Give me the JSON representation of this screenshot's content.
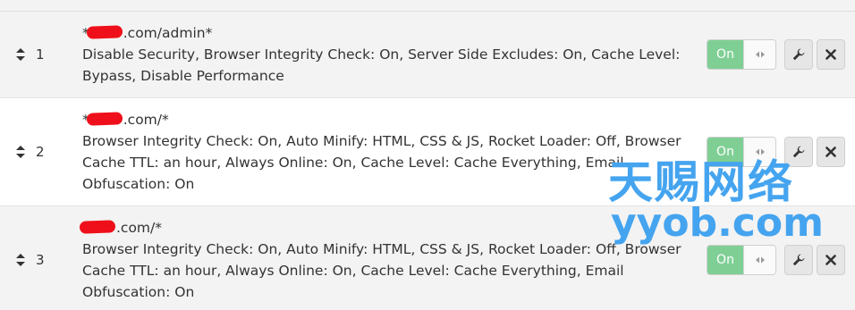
{
  "rules": [
    {
      "number": "1",
      "url_prefix": "*",
      "url_suffix": ".com/admin*",
      "settings": "Disable Security, Browser Integrity Check: On, Server Side Excludes: On, Cache Level: Bypass, Disable Performance",
      "toggle_label": "On"
    },
    {
      "number": "2",
      "url_prefix": "*",
      "url_suffix": ".com/*",
      "settings": "Browser Integrity Check: On, Auto Minify: HTML, CSS & JS, Rocket Loader: Off, Browser Cache TTL: an hour, Always Online: On, Cache Level: Cache Everything, Email Obfuscation: On",
      "toggle_label": "On"
    },
    {
      "number": "3",
      "url_prefix": "",
      "url_suffix": ".com/*",
      "settings": "Browser Integrity Check: On, Auto Minify: HTML, CSS & JS, Rocket Loader: Off, Browser Cache TTL: an hour, Always Online: On, Cache Level: Cache Everything, Email Obfuscation: On",
      "toggle_label": "On"
    }
  ],
  "watermark": {
    "chinese": "天赐网络",
    "url": "yyob.com"
  },
  "colors": {
    "toggle_on": "#7fcf95",
    "redaction": "#ef0f1a",
    "watermark": "#45a4ef",
    "alt_row": "#f3f3f3"
  },
  "icons": {
    "drag": "updown-arrows-icon",
    "toggle": "resize-arrows-icon",
    "edit": "wrench-icon",
    "delete": "close-x-icon"
  }
}
